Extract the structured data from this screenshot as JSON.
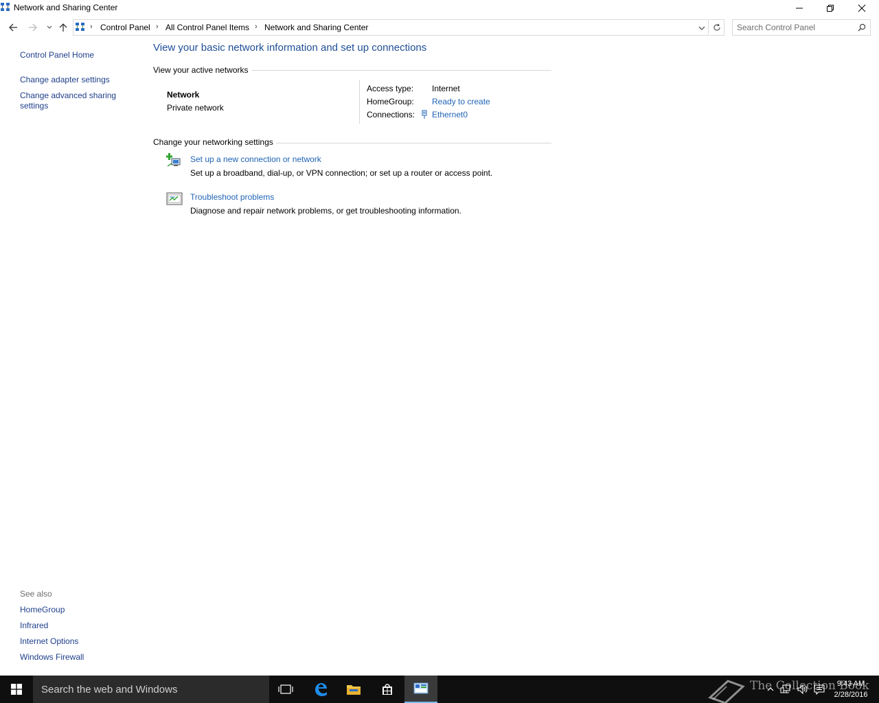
{
  "window": {
    "title": "Network and Sharing Center"
  },
  "address_bar": {
    "crumbs": [
      "Control Panel",
      "All Control Panel Items",
      "Network and Sharing Center"
    ],
    "search_placeholder": "Search Control Panel"
  },
  "left_pane": {
    "home": "Control Panel Home",
    "links": [
      "Change adapter settings",
      "Change advanced sharing",
      "settings"
    ]
  },
  "main": {
    "title": "View your basic network information and set up connections",
    "active_networks_label": "View your active networks",
    "network": {
      "name": "Network",
      "type": "Private network",
      "access_type_label": "Access type:",
      "access_type_value": "Internet",
      "homegroup_label": "HomeGroup:",
      "homegroup_value": "Ready to create",
      "connections_label": "Connections:",
      "connections_value": "Ethernet0"
    },
    "change_settings_label": "Change your networking settings",
    "tasks": [
      {
        "title": "Set up a new connection or network",
        "desc": "Set up a broadband, dial-up, or VPN connection; or set up a router or access point."
      },
      {
        "title": "Troubleshoot problems",
        "desc": "Diagnose and repair network problems, or get troubleshooting information."
      }
    ]
  },
  "see_also": {
    "title": "See also",
    "links": [
      "HomeGroup",
      "Infrared",
      "Internet Options",
      "Windows Firewall"
    ]
  },
  "taskbar": {
    "search_text": "Search the web and Windows",
    "time": "9:43 AM",
    "date": "2/28/2016",
    "watermark": "The Collection Book"
  },
  "colors": {
    "link": "#1f63b5",
    "title": "#1e4e96",
    "taskbar": "#0f0f10",
    "cortana": "#2b2b2b"
  }
}
